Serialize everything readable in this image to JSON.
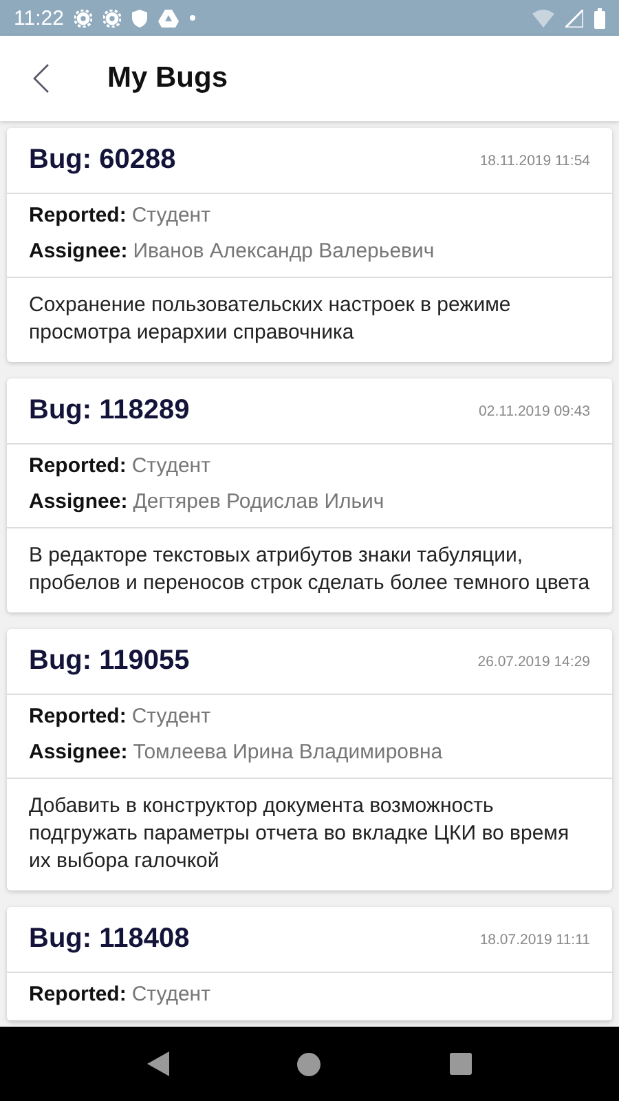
{
  "status_bar": {
    "time": "11:22"
  },
  "app_bar": {
    "title": "My Bugs"
  },
  "bugs": [
    {
      "title": "Bug: 60288",
      "date": "18.11.2019 11:54",
      "reported_label": "Reported:",
      "reported": "Студент",
      "assignee_label": "Assignee:",
      "assignee": "Иванов Александр Валерьевич",
      "description": "Сохранение пользовательских настроек в режиме просмотра иерархии справочника"
    },
    {
      "title": "Bug: 118289",
      "date": "02.11.2019 09:43",
      "reported_label": "Reported:",
      "reported": "Студент",
      "assignee_label": "Assignee:",
      "assignee": "Дегтярев Родислав Ильич",
      "description": "В редакторе текстовых атрибутов знаки табуляции, пробелов и переносов строк сделать более темного цвета"
    },
    {
      "title": "Bug: 119055",
      "date": "26.07.2019 14:29",
      "reported_label": "Reported:",
      "reported": "Студент",
      "assignee_label": "Assignee:",
      "assignee": "Томлеева Ирина Владимировна",
      "description": "Добавить в конструктор документа возможность подгружать параметры отчета во вкладке ЦКИ во время их выбора галочкой"
    },
    {
      "title": "Bug: 118408",
      "date": "18.07.2019 11:11",
      "reported_label": "Reported:",
      "reported": "Студент"
    }
  ]
}
